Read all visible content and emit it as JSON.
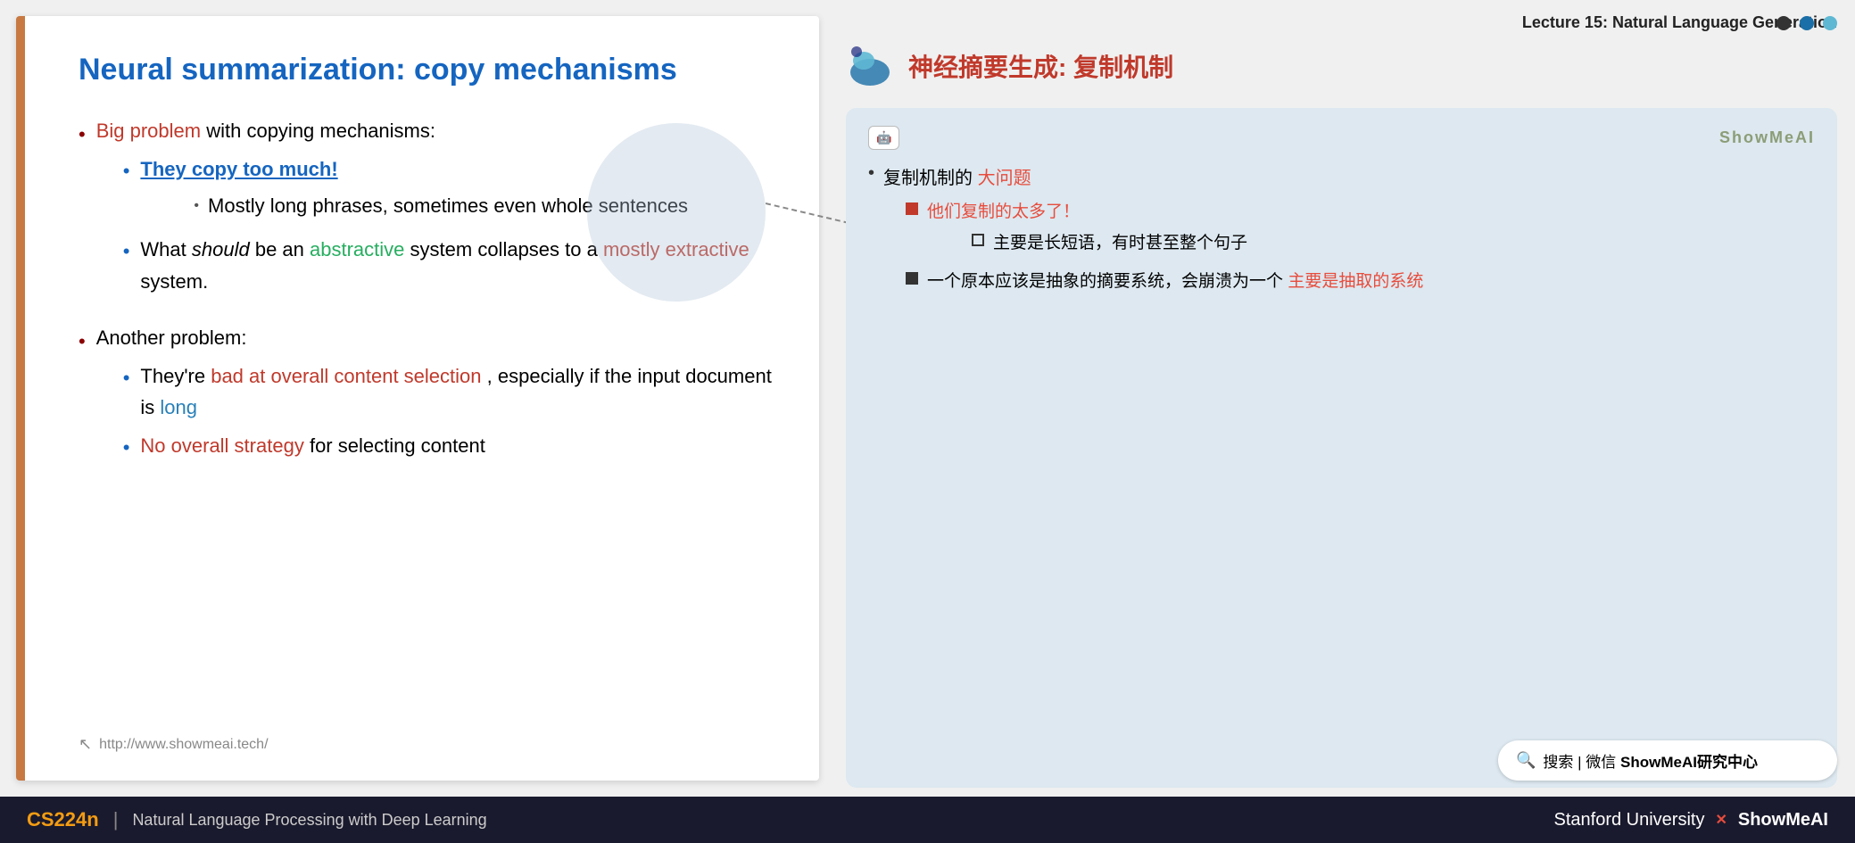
{
  "lecture": {
    "title": "Lecture 15: Natural Language Generation"
  },
  "left_slide": {
    "title": "Neural summarization: copy mechanisms",
    "bullets": [
      {
        "level": 1,
        "text_parts": [
          {
            "text": "Big problem",
            "color": "red"
          },
          {
            "text": " with copying mechanisms:",
            "color": "black"
          }
        ],
        "children": [
          {
            "level": 2,
            "text_parts": [
              {
                "text": "They copy too much!",
                "color": "blue-link"
              }
            ],
            "children": [
              {
                "level": 3,
                "text_parts": [
                  {
                    "text": "Mostly long phrases, sometimes even whole sentences",
                    "color": "black"
                  }
                ]
              }
            ]
          },
          {
            "level": 2,
            "text_parts": [
              {
                "text": "What ",
                "color": "black"
              },
              {
                "text": "should",
                "color": "black",
                "italic": true
              },
              {
                "text": " be an ",
                "color": "black"
              },
              {
                "text": "abstractive",
                "color": "green"
              },
              {
                "text": " system collapses to a ",
                "color": "black"
              },
              {
                "text": "mostly extractive",
                "color": "red"
              },
              {
                "text": " system.",
                "color": "black"
              }
            ]
          }
        ]
      },
      {
        "level": 1,
        "text_parts": [
          {
            "text": "Another problem:",
            "color": "black"
          }
        ],
        "children": [
          {
            "level": 2,
            "text_parts": [
              {
                "text": "They're ",
                "color": "black"
              },
              {
                "text": "bad at overall content selection",
                "color": "red"
              },
              {
                "text": ", especially if the input document is ",
                "color": "black"
              },
              {
                "text": "long",
                "color": "blue"
              }
            ]
          },
          {
            "level": 2,
            "text_parts": [
              {
                "text": "No overall strategy",
                "color": "red"
              },
              {
                "text": " for selecting content",
                "color": "black"
              }
            ]
          }
        ]
      }
    ],
    "footer_url": "http://www.showmeai.tech/"
  },
  "right_panel": {
    "logo_alt": "ShowMeAI logo",
    "title_cn": "神经摘要生成: 复制机制",
    "nav_dots": [
      "dark",
      "blue",
      "light-blue"
    ],
    "card": {
      "ai_icon": "AI",
      "brand": "ShowMeAI",
      "bullets": [
        {
          "text_parts": [
            {
              "text": "复制机制的",
              "color": "black"
            },
            {
              "text": "大问题",
              "color": "red"
            }
          ],
          "children": [
            {
              "type": "red-square",
              "text_parts": [
                {
                  "text": "他们复制的太多了！",
                  "color": "red"
                }
              ],
              "children": [
                {
                  "type": "hollow-square",
                  "text_parts": [
                    {
                      "text": "主要是长短语，有时甚至整个句子",
                      "color": "black"
                    }
                  ]
                }
              ]
            },
            {
              "type": "dark-square",
              "text_parts": [
                {
                  "text": "一个原本应该是抽象的摘要系统，会崩溃为一个",
                  "color": "black"
                },
                {
                  "text": "主要是抽取的系统",
                  "color": "red"
                }
              ]
            }
          ]
        }
      ]
    },
    "search_bar": {
      "icon": "🔍",
      "text": "搜索 | 微信 ShowMeAI研究中心"
    }
  },
  "bottom_bar": {
    "course_code": "CS224n",
    "divider": "|",
    "subtitle": "Natural Language Processing with Deep Learning",
    "right_text_1": "Stanford University",
    "right_x": "✕",
    "right_text_2": "ShowMeAI"
  }
}
